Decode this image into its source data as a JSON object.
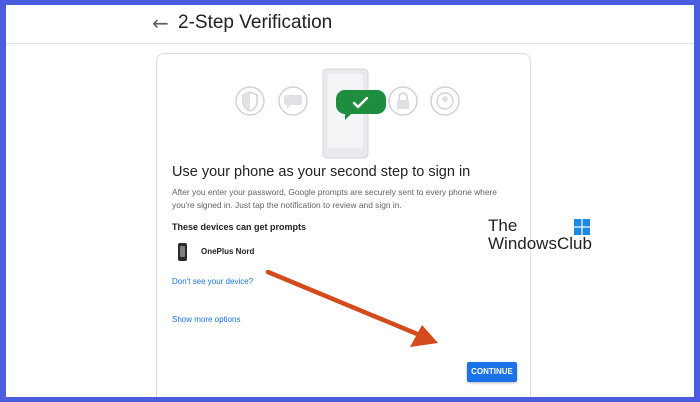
{
  "header": {
    "back_icon": "arrow-left-icon",
    "title": "2-Step Verification"
  },
  "card": {
    "illustration_icons": [
      "shield-icon",
      "chat-bubble-icon",
      "check-bubble-icon",
      "lock-icon",
      "account-icon"
    ],
    "heading": "Use your phone as your second step to sign in",
    "description": "After you enter your password, Google prompts are securely sent to every phone where you're signed in. Just tap the notification to review and sign in.",
    "devices_heading": "These devices can get prompts",
    "devices": [
      {
        "name": "OnePlus Nord",
        "icon": "phone-icon"
      }
    ],
    "missing_device_link": "Don't see your device?",
    "more_options_link": "Show more options",
    "continue_label": "CONTINUE"
  },
  "watermark": {
    "line1": "The",
    "line2": "WindowsClub"
  },
  "colors": {
    "accent": "#1a73e8",
    "check_green": "#1e8e3e",
    "annotation_arrow": "#d44a1c",
    "border": "#4a5ce0"
  }
}
